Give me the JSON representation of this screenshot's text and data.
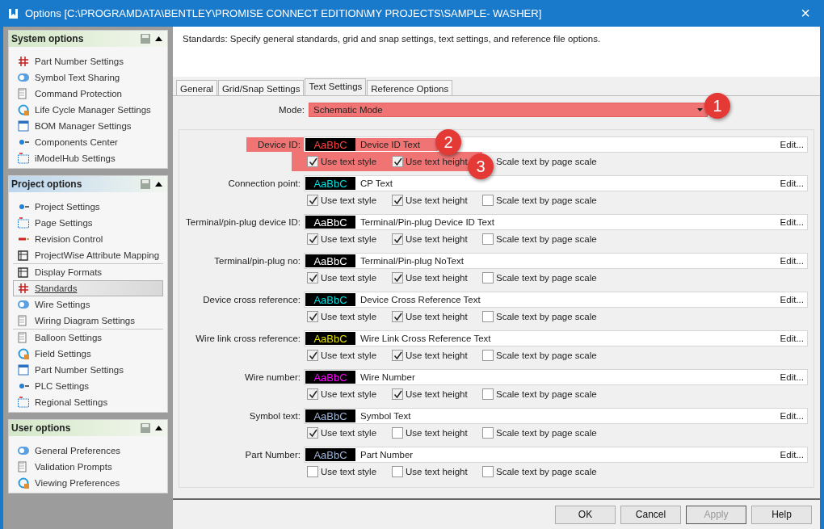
{
  "window": {
    "title": "Options [C:\\PROGRAMDATA\\BENTLEY\\PROMISE CONNECT EDITION\\MY PROJECTS\\SAMPLE- WASHER]",
    "close": "×"
  },
  "sidebar": [
    {
      "title": "System options",
      "color": "#d4e8c8",
      "expanded": true,
      "groups": [
        [
          {
            "label": "Part Number Settings",
            "selected": false
          },
          {
            "label": "Symbol Text Sharing",
            "selected": false
          },
          {
            "label": "Command Protection",
            "selected": false
          },
          {
            "label": "Life Cycle Manager Settings",
            "selected": false
          },
          {
            "label": "BOM Manager Settings",
            "selected": false
          },
          {
            "label": "Components Center",
            "selected": false
          },
          {
            "label": "iModelHub Settings",
            "selected": false
          }
        ]
      ]
    },
    {
      "title": "Project options",
      "color": "#bcd6ee",
      "expanded": true,
      "groups": [
        [
          {
            "label": "Project Settings",
            "selected": false
          },
          {
            "label": "Page Settings",
            "selected": false
          },
          {
            "label": "Revision Control",
            "selected": false
          },
          {
            "label": "ProjectWise Attribute Mapping",
            "selected": false
          }
        ],
        [
          {
            "label": "Display Formats",
            "selected": false
          },
          {
            "label": "Standards",
            "selected": true
          },
          {
            "label": "Wire Settings",
            "selected": false
          },
          {
            "label": "Wiring Diagram Settings",
            "selected": false
          }
        ],
        [
          {
            "label": "Balloon Settings",
            "selected": false
          },
          {
            "label": "Field Settings",
            "selected": false
          },
          {
            "label": "Part Number Settings",
            "selected": false
          },
          {
            "label": "PLC Settings",
            "selected": false
          },
          {
            "label": "Regional Settings",
            "selected": false
          }
        ]
      ]
    },
    {
      "title": "User options",
      "color": "#d4e8c8",
      "expanded": true,
      "groups": [
        [
          {
            "label": "General Preferences",
            "selected": false
          },
          {
            "label": "Validation Prompts",
            "selected": false
          },
          {
            "label": "Viewing Preferences",
            "selected": false
          }
        ]
      ]
    }
  ],
  "description": "Standards: Specify general standards, grid and snap settings, text settings, and reference file options.",
  "tabs": [
    {
      "label": "General",
      "selected": false
    },
    {
      "label": "Grid/Snap Settings",
      "selected": false
    },
    {
      "label": "Text Settings",
      "selected": true
    },
    {
      "label": "Reference Options",
      "selected": false
    }
  ],
  "mode": {
    "label": "Mode:",
    "value": "Schematic Mode",
    "highlighted": true
  },
  "text_settings": [
    {
      "label": "Device ID:",
      "sample": "AaBbC",
      "kind": "red",
      "style": "Device ID Text",
      "edit": "Edit...",
      "highlighted": true,
      "options_highlighted": true,
      "options": [
        {
          "label": "Use text style",
          "checked": true
        },
        {
          "label": "Use text height",
          "checked": true
        },
        {
          "label": "Scale text by page scale"
        }
      ]
    },
    {
      "label": "Connection point:",
      "sample": "AaBbC",
      "kind": "cyan",
      "style": "CP Text",
      "edit": "Edit...",
      "highlighted": false,
      "options_highlighted": false,
      "options": [
        {
          "label": "Use text style",
          "checked": true
        },
        {
          "label": "Use text height",
          "checked": true
        },
        {
          "label": "Scale text by page scale",
          "checked": false
        }
      ]
    },
    {
      "label": "Terminal/pin-plug device ID:",
      "sample": "AaBbC",
      "kind": "white",
      "style": "Terminal/Pin-plug Device ID Text",
      "edit": "Edit...",
      "highlighted": false,
      "options_highlighted": false,
      "options": [
        {
          "label": "Use text style",
          "checked": true
        },
        {
          "label": "Use text height",
          "checked": true
        },
        {
          "label": "Scale text by page scale",
          "checked": false
        }
      ]
    },
    {
      "label": "Terminal/pin-plug no:",
      "sample": "AaBbC",
      "kind": "white",
      "style": "Terminal/Pin-plug NoText",
      "edit": "Edit...",
      "highlighted": false,
      "options_highlighted": false,
      "options": [
        {
          "label": "Use text style",
          "checked": true
        },
        {
          "label": "Use text height",
          "checked": true
        },
        {
          "label": "Scale text by page scale",
          "checked": false
        }
      ]
    },
    {
      "label": "Device cross reference:",
      "sample": "AaBbC",
      "kind": "cyan",
      "style": "Device Cross Reference Text",
      "edit": "Edit...",
      "highlighted": false,
      "options_highlighted": false,
      "options": [
        {
          "label": "Use text style",
          "checked": true
        },
        {
          "label": "Use text height",
          "checked": true
        },
        {
          "label": "Scale text by page scale",
          "checked": false
        }
      ]
    },
    {
      "label": "Wire link cross reference:",
      "sample": "AaBbC",
      "kind": "yellow",
      "style": "Wire Link Cross Reference Text",
      "edit": "Edit...",
      "highlighted": false,
      "options_highlighted": false,
      "options": [
        {
          "label": "Use text style",
          "checked": true
        },
        {
          "label": "Use text height",
          "checked": true
        },
        {
          "label": "Scale text by page scale",
          "checked": false
        }
      ]
    },
    {
      "label": "Wire number:",
      "sample": "AaBbC",
      "kind": "magenta",
      "style": "Wire Number",
      "edit": "Edit...",
      "highlighted": false,
      "options_highlighted": false,
      "options": [
        {
          "label": "Use text style",
          "checked": true
        },
        {
          "label": "Use text height",
          "checked": true
        },
        {
          "label": "Scale text by page scale",
          "checked": false
        }
      ]
    },
    {
      "label": "Symbol text:",
      "sample": "AaBbC",
      "kind": "grey",
      "style": "Symbol Text",
      "edit": "Edit...",
      "highlighted": false,
      "options_highlighted": false,
      "options": [
        {
          "label": "Use text style",
          "checked": true
        },
        {
          "label": "Use text height",
          "checked": false
        },
        {
          "label": "Scale text by page scale",
          "checked": false
        }
      ]
    },
    {
      "label": "Part Number:",
      "sample": "AaBbC",
      "kind": "grey",
      "style": "Part Number",
      "edit": "Edit...",
      "highlighted": false,
      "options_highlighted": false,
      "options": [
        {
          "label": "Use text style",
          "checked": false
        },
        {
          "label": "Use text height",
          "checked": false
        },
        {
          "label": "Scale text by page scale",
          "checked": false
        }
      ]
    }
  ],
  "callouts": [
    "1",
    "2",
    "3"
  ],
  "buttons": [
    {
      "label": "OK",
      "disabled": false
    },
    {
      "label": "Cancel",
      "disabled": false
    },
    {
      "label": "Apply",
      "disabled": true
    },
    {
      "label": "Help",
      "disabled": false
    }
  ]
}
